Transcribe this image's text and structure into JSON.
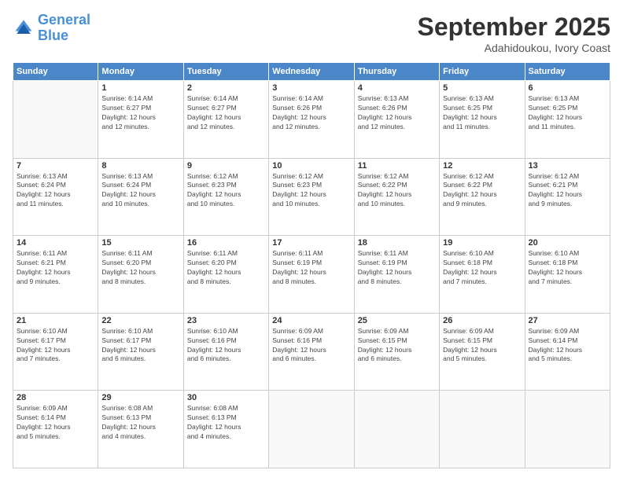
{
  "header": {
    "logo_line1": "General",
    "logo_line2": "Blue",
    "month": "September 2025",
    "location": "Adahidoukou, Ivory Coast"
  },
  "weekdays": [
    "Sunday",
    "Monday",
    "Tuesday",
    "Wednesday",
    "Thursday",
    "Friday",
    "Saturday"
  ],
  "weeks": [
    [
      {
        "day": "",
        "info": ""
      },
      {
        "day": "1",
        "info": "Sunrise: 6:14 AM\nSunset: 6:27 PM\nDaylight: 12 hours\nand 12 minutes."
      },
      {
        "day": "2",
        "info": "Sunrise: 6:14 AM\nSunset: 6:27 PM\nDaylight: 12 hours\nand 12 minutes."
      },
      {
        "day": "3",
        "info": "Sunrise: 6:14 AM\nSunset: 6:26 PM\nDaylight: 12 hours\nand 12 minutes."
      },
      {
        "day": "4",
        "info": "Sunrise: 6:13 AM\nSunset: 6:26 PM\nDaylight: 12 hours\nand 12 minutes."
      },
      {
        "day": "5",
        "info": "Sunrise: 6:13 AM\nSunset: 6:25 PM\nDaylight: 12 hours\nand 11 minutes."
      },
      {
        "day": "6",
        "info": "Sunrise: 6:13 AM\nSunset: 6:25 PM\nDaylight: 12 hours\nand 11 minutes."
      }
    ],
    [
      {
        "day": "7",
        "info": "Sunrise: 6:13 AM\nSunset: 6:24 PM\nDaylight: 12 hours\nand 11 minutes."
      },
      {
        "day": "8",
        "info": "Sunrise: 6:13 AM\nSunset: 6:24 PM\nDaylight: 12 hours\nand 10 minutes."
      },
      {
        "day": "9",
        "info": "Sunrise: 6:12 AM\nSunset: 6:23 PM\nDaylight: 12 hours\nand 10 minutes."
      },
      {
        "day": "10",
        "info": "Sunrise: 6:12 AM\nSunset: 6:23 PM\nDaylight: 12 hours\nand 10 minutes."
      },
      {
        "day": "11",
        "info": "Sunrise: 6:12 AM\nSunset: 6:22 PM\nDaylight: 12 hours\nand 10 minutes."
      },
      {
        "day": "12",
        "info": "Sunrise: 6:12 AM\nSunset: 6:22 PM\nDaylight: 12 hours\nand 9 minutes."
      },
      {
        "day": "13",
        "info": "Sunrise: 6:12 AM\nSunset: 6:21 PM\nDaylight: 12 hours\nand 9 minutes."
      }
    ],
    [
      {
        "day": "14",
        "info": "Sunrise: 6:11 AM\nSunset: 6:21 PM\nDaylight: 12 hours\nand 9 minutes."
      },
      {
        "day": "15",
        "info": "Sunrise: 6:11 AM\nSunset: 6:20 PM\nDaylight: 12 hours\nand 8 minutes."
      },
      {
        "day": "16",
        "info": "Sunrise: 6:11 AM\nSunset: 6:20 PM\nDaylight: 12 hours\nand 8 minutes."
      },
      {
        "day": "17",
        "info": "Sunrise: 6:11 AM\nSunset: 6:19 PM\nDaylight: 12 hours\nand 8 minutes."
      },
      {
        "day": "18",
        "info": "Sunrise: 6:11 AM\nSunset: 6:19 PM\nDaylight: 12 hours\nand 8 minutes."
      },
      {
        "day": "19",
        "info": "Sunrise: 6:10 AM\nSunset: 6:18 PM\nDaylight: 12 hours\nand 7 minutes."
      },
      {
        "day": "20",
        "info": "Sunrise: 6:10 AM\nSunset: 6:18 PM\nDaylight: 12 hours\nand 7 minutes."
      }
    ],
    [
      {
        "day": "21",
        "info": "Sunrise: 6:10 AM\nSunset: 6:17 PM\nDaylight: 12 hours\nand 7 minutes."
      },
      {
        "day": "22",
        "info": "Sunrise: 6:10 AM\nSunset: 6:17 PM\nDaylight: 12 hours\nand 6 minutes."
      },
      {
        "day": "23",
        "info": "Sunrise: 6:10 AM\nSunset: 6:16 PM\nDaylight: 12 hours\nand 6 minutes."
      },
      {
        "day": "24",
        "info": "Sunrise: 6:09 AM\nSunset: 6:16 PM\nDaylight: 12 hours\nand 6 minutes."
      },
      {
        "day": "25",
        "info": "Sunrise: 6:09 AM\nSunset: 6:15 PM\nDaylight: 12 hours\nand 6 minutes."
      },
      {
        "day": "26",
        "info": "Sunrise: 6:09 AM\nSunset: 6:15 PM\nDaylight: 12 hours\nand 5 minutes."
      },
      {
        "day": "27",
        "info": "Sunrise: 6:09 AM\nSunset: 6:14 PM\nDaylight: 12 hours\nand 5 minutes."
      }
    ],
    [
      {
        "day": "28",
        "info": "Sunrise: 6:09 AM\nSunset: 6:14 PM\nDaylight: 12 hours\nand 5 minutes."
      },
      {
        "day": "29",
        "info": "Sunrise: 6:08 AM\nSunset: 6:13 PM\nDaylight: 12 hours\nand 4 minutes."
      },
      {
        "day": "30",
        "info": "Sunrise: 6:08 AM\nSunset: 6:13 PM\nDaylight: 12 hours\nand 4 minutes."
      },
      {
        "day": "",
        "info": ""
      },
      {
        "day": "",
        "info": ""
      },
      {
        "day": "",
        "info": ""
      },
      {
        "day": "",
        "info": ""
      }
    ]
  ]
}
